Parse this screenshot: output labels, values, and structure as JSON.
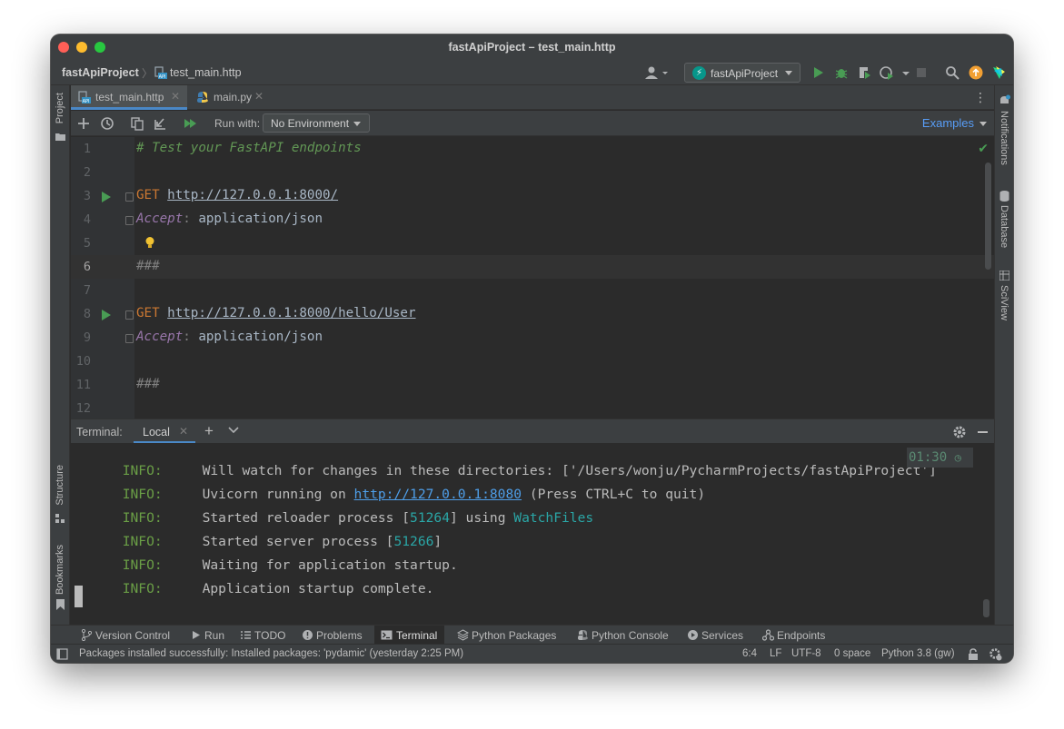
{
  "window": {
    "title": "fastApiProject – test_main.http"
  },
  "navbar": {
    "project": "fastApiProject",
    "file": "test_main.http",
    "run_config": "fastApiProject"
  },
  "side_tabs": {
    "left": [
      "Project",
      "Structure",
      "Bookmarks"
    ],
    "right": [
      "Notifications",
      "Database",
      "SciView"
    ]
  },
  "editor_tabs": [
    {
      "label": "test_main.http",
      "icon": "api-file-icon",
      "active": true
    },
    {
      "label": "main.py",
      "icon": "python-file-icon",
      "active": false
    }
  ],
  "http_toolbar": {
    "run_with_label": "Run with:",
    "environment": "No Environment",
    "examples": "Examples"
  },
  "editor": {
    "current_line": 6,
    "lines": [
      {
        "n": "1",
        "text": "# Test your FastAPI endpoints"
      },
      {
        "n": "2",
        "text": ""
      },
      {
        "n": "3",
        "method": "GET",
        "url": "http://127.0.0.1:8000/"
      },
      {
        "n": "4",
        "header": "Accept",
        "value": "application/json"
      },
      {
        "n": "5",
        "text": ""
      },
      {
        "n": "6",
        "text": "###"
      },
      {
        "n": "7",
        "text": ""
      },
      {
        "n": "8",
        "method": "GET",
        "url": "http://127.0.0.1:8000/hello/User"
      },
      {
        "n": "9",
        "header": "Accept",
        "value": "application/json"
      },
      {
        "n": "10",
        "text": ""
      },
      {
        "n": "11",
        "text": "###"
      },
      {
        "n": "12",
        "text": ""
      }
    ]
  },
  "terminal": {
    "label": "Terminal:",
    "tab": "Local",
    "elapsed": "01:30",
    "lines": [
      {
        "level": "INFO:",
        "text": "Will watch for changes in these directories: ['/Users/wonju/PycharmProjects/fastApiProject']"
      },
      {
        "level": "INFO:",
        "pre": "Uvicorn running on ",
        "link": "http://127.0.0.1:8080",
        "post": " (Press CTRL+C to quit)"
      },
      {
        "level": "INFO:",
        "pre": "Started reloader process [",
        "num": "51264",
        "mid": "] using ",
        "hl": "WatchFiles"
      },
      {
        "level": "INFO:",
        "pre": "Started server process [",
        "num": "51266",
        "mid": "]"
      },
      {
        "level": "INFO:",
        "text": "Waiting for application startup."
      },
      {
        "level": "INFO:",
        "text": "Application startup complete."
      }
    ]
  },
  "bottom_tabs": [
    {
      "label": "Version Control",
      "icon": "branch-icon"
    },
    {
      "label": "Run",
      "icon": "play-icon"
    },
    {
      "label": "TODO",
      "icon": "list-icon"
    },
    {
      "label": "Problems",
      "icon": "warning-icon"
    },
    {
      "label": "Terminal",
      "icon": "terminal-icon",
      "active": true
    },
    {
      "label": "Python Packages",
      "icon": "layers-icon"
    },
    {
      "label": "Python Console",
      "icon": "python-icon"
    },
    {
      "label": "Services",
      "icon": "services-icon"
    },
    {
      "label": "Endpoints",
      "icon": "endpoints-icon"
    }
  ],
  "statusbar": {
    "message": "Packages installed successfully: Installed packages: 'pydamic' (yesterday 2:25 PM)",
    "position": "6:4",
    "line_sep": "LF",
    "encoding": "UTF-8",
    "indent": "0 space",
    "interpreter": "Python 3.8 (gw)"
  },
  "colors": {
    "accent": "#4a88c7",
    "run_green": "#499c54",
    "link": "#4e9ee8"
  }
}
